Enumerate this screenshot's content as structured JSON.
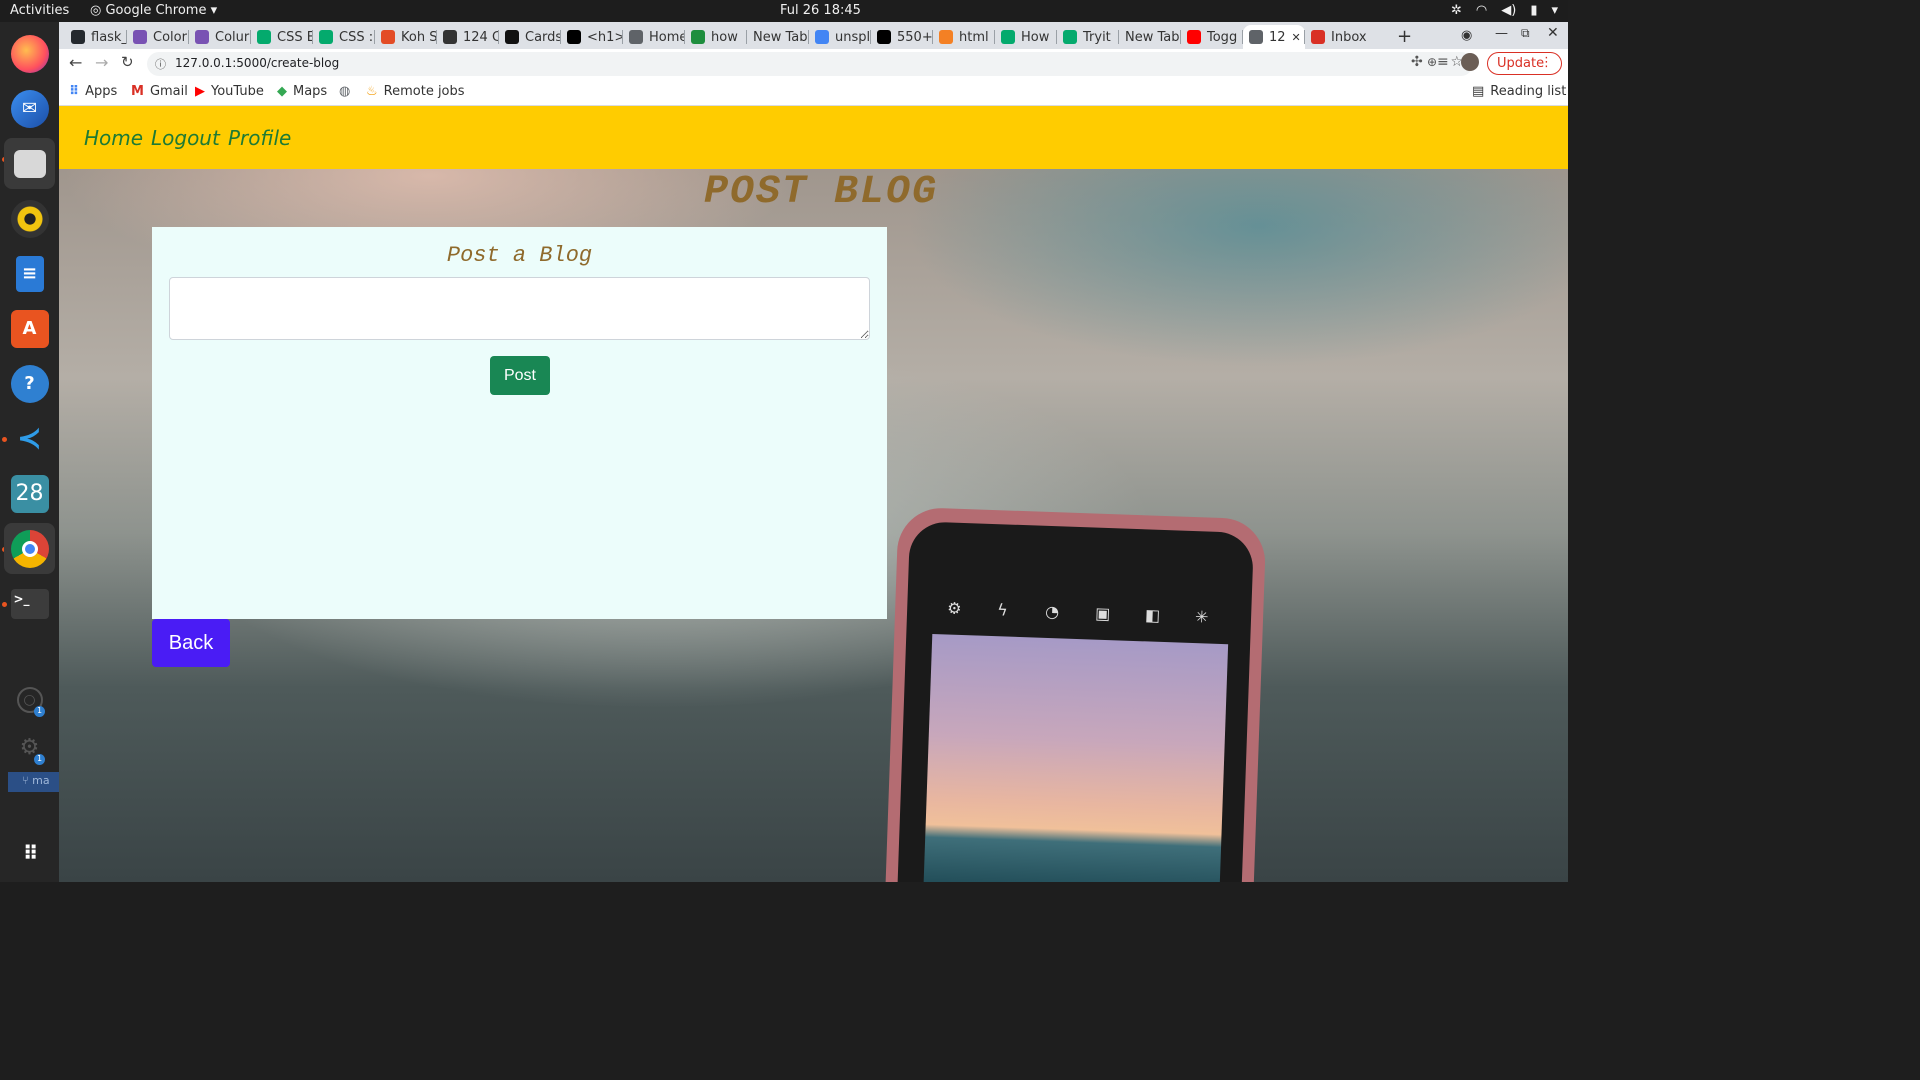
{
  "system": {
    "activities": "Activities",
    "app_menu": "Google Chrome",
    "clock": "Ful 26  18:45"
  },
  "dock": {
    "items": [
      "firefox",
      "thunderbird",
      "files",
      "rhythmbox",
      "libreoffice-writer",
      "ubuntu-software",
      "help",
      "vscode",
      "calendar",
      "chrome",
      "terminal",
      "accounts",
      "settings",
      "show-applications"
    ],
    "calendar_day": "28",
    "calendar_badge": "1",
    "settings_badge": "1",
    "branch_label": "ma"
  },
  "browser": {
    "tabs": [
      {
        "label": "flask_",
        "icon": "github-icon"
      },
      {
        "label": "Color",
        "icon": "bootstrap-icon"
      },
      {
        "label": "Colur",
        "icon": "bootstrap-icon"
      },
      {
        "label": "CSS E",
        "icon": "w3schools-icon"
      },
      {
        "label": "CSS :l",
        "icon": "w3schools-icon"
      },
      {
        "label": "Koh S",
        "icon": "flutter-icon"
      },
      {
        "label": "124 C",
        "icon": "f-icon"
      },
      {
        "label": "Cards",
        "icon": "codepen-icon"
      },
      {
        "label": "<h1>",
        "icon": "h1-icon"
      },
      {
        "label": "Home",
        "icon": "globe-icon"
      },
      {
        "label": "how",
        "icon": "cross-icon"
      },
      {
        "label": "New Tab",
        "icon": ""
      },
      {
        "label": "unspl",
        "icon": "google-icon"
      },
      {
        "label": "550+",
        "icon": "unsplash-icon"
      },
      {
        "label": "html",
        "icon": "stackoverflow-icon"
      },
      {
        "label": "How",
        "icon": "w3schools-icon"
      },
      {
        "label": "Tryit",
        "icon": "w3schools-icon"
      },
      {
        "label": "New Tab",
        "icon": ""
      },
      {
        "label": "Togg",
        "icon": "youtube-icon"
      },
      {
        "label": "12",
        "icon": "globe-icon",
        "active": true
      },
      {
        "label": "Inbox",
        "icon": "gmail-icon"
      }
    ],
    "url": "127.0.0.1:5000/create-blog",
    "update_label": "Update",
    "bookmarks": [
      {
        "label": "Apps",
        "icon": "apps-grid-icon"
      },
      {
        "label": "Gmail",
        "icon": "gmail-icon"
      },
      {
        "label": "YouTube",
        "icon": "youtube-icon"
      },
      {
        "label": "Maps",
        "icon": "maps-icon"
      },
      {
        "label": "",
        "icon": "globe-icon"
      },
      {
        "label": "Remote jobs",
        "icon": "remote-jobs-icon"
      }
    ],
    "reading_list": "Reading list"
  },
  "page": {
    "nav": {
      "home": "Home",
      "logout": "Logout",
      "profile": "Profile"
    },
    "title": "POST BLOG",
    "form": {
      "heading": "Post a Blog",
      "textarea_value": "",
      "submit_label": "Post"
    },
    "back_label": "Back"
  },
  "colors": {
    "navbar": "#ffcc00",
    "nav_link": "#1e7a34",
    "title": "#8f6a2c",
    "card_bg": "#ecfdfb",
    "post_button": "#198754",
    "back_button": "#4a1cf5"
  }
}
